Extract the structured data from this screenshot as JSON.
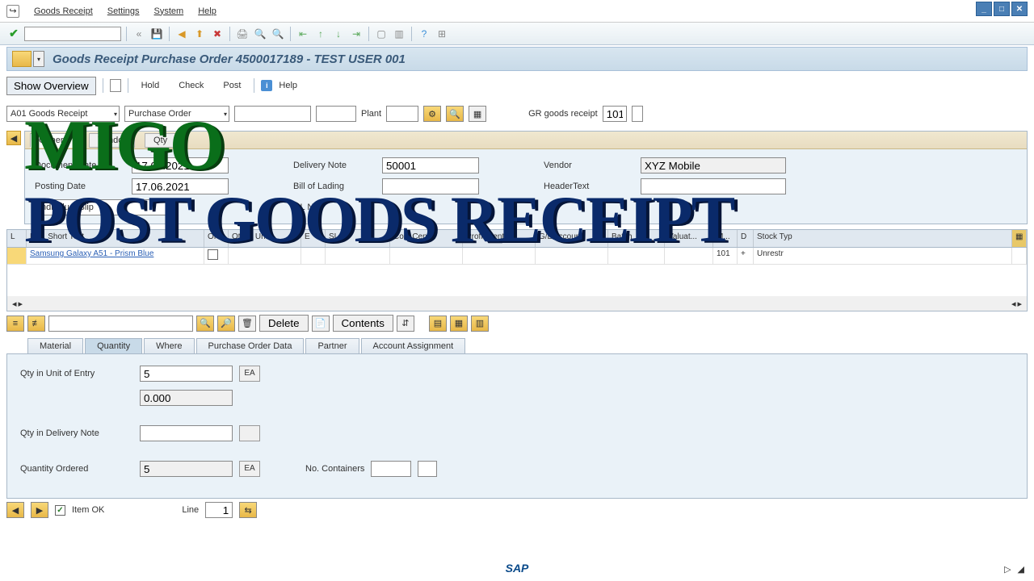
{
  "menu": {
    "items": [
      "Goods Receipt",
      "Settings",
      "System",
      "Help"
    ]
  },
  "title": "Goods Receipt Purchase Order 4500017189 - TEST USER 001",
  "actions": {
    "show_overview": "Show Overview",
    "hold": "Hold",
    "check": "Check",
    "post": "Post",
    "help": "Help"
  },
  "filters": {
    "action_dd": "A01 Goods Receipt",
    "ref_dd": "Purchase Order",
    "plant_label": "Plant",
    "gr_label": "GR goods receipt",
    "gr_code": "101"
  },
  "header": {
    "tabs": [
      "General",
      "Vendor",
      "Qty"
    ],
    "doc_date_label": "Document Date",
    "doc_date": "17.06.2021",
    "post_date_label": "Posting Date",
    "post_date": "17.06.2021",
    "slip_label": "Individual Slip",
    "delivery_note_label": "Delivery Note",
    "delivery_note": "50001",
    "bol_label": "Bill of Lading",
    "gl_label": "GL No",
    "vendor_label": "Vendor",
    "vendor": "XYZ Mobile",
    "headertext_label": "HeaderText"
  },
  "grid": {
    "cols": [
      "L",
      "Mat. Short Text",
      "OK",
      "Qty in UnE",
      "E",
      "SLoc",
      "Cost Center",
      "Profit Center",
      "G/L Account",
      "Batch",
      "Valuat...",
      "M...",
      "D",
      "Stock Typ"
    ],
    "row": {
      "mat": "Samsung Galaxy A51 - Prism Blue",
      "mvt": "101",
      "sign": "+",
      "stype": "Unrestr"
    }
  },
  "table_actions": {
    "delete": "Delete",
    "contents": "Contents"
  },
  "detail": {
    "tabs": [
      "Material",
      "Quantity",
      "Where",
      "Purchase Order Data",
      "Partner",
      "Account Assignment"
    ],
    "qty_entry_label": "Qty in Unit of Entry",
    "qty_entry": "5",
    "qty_entry_unit": "EA",
    "qty_zero": "0.000",
    "qty_delivery_label": "Qty in Delivery Note",
    "qty_ordered_label": "Quantity Ordered",
    "qty_ordered": "5",
    "qty_ordered_unit": "EA",
    "containers_label": "No. Containers"
  },
  "bottom": {
    "item_ok": "Item OK",
    "line_label": "Line",
    "line_val": "1"
  },
  "overlay": {
    "line1": "MIGO",
    "line2": "POST GOODS RECEIPT"
  },
  "logo": "SAP"
}
